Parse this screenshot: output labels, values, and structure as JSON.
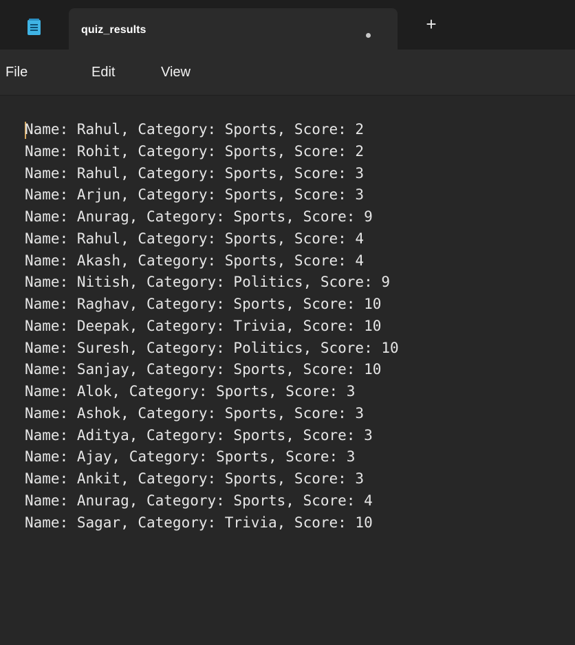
{
  "tab": {
    "title": "quiz_results",
    "unsaved_indicator": "●",
    "new_tab_label": "+"
  },
  "menu": {
    "file": "File",
    "edit": "Edit",
    "view": "View"
  },
  "document": {
    "lines": [
      "Name: Rahul, Category: Sports, Score: 2",
      "Name: Rohit, Category: Sports, Score: 2",
      "Name: Rahul, Category: Sports, Score: 3",
      "Name: Arjun, Category: Sports, Score: 3",
      "Name: Anurag, Category: Sports, Score: 9",
      "Name: Rahul, Category: Sports, Score: 4",
      "Name: Akash, Category: Sports, Score: 4",
      "Name: Nitish, Category: Politics, Score: 9",
      "Name: Raghav, Category: Sports, Score: 10",
      "Name: Deepak, Category: Trivia, Score: 10",
      "Name: Suresh, Category: Politics, Score: 10",
      "Name: Sanjay, Category: Sports, Score: 10",
      "Name: Alok, Category: Sports, Score: 3",
      "Name: Ashok, Category: Sports, Score: 3",
      "Name: Aditya, Category: Sports, Score: 3",
      "Name: Ajay, Category: Sports, Score: 3",
      "Name: Ankit, Category: Sports, Score: 3",
      "Name: Anurag, Category: Sports, Score: 4",
      "Name: Sagar, Category: Trivia, Score: 10"
    ]
  },
  "icons": {
    "app": "notepad-icon",
    "new_tab": "plus-icon"
  },
  "colors": {
    "background": "#272727",
    "titlebar": "#1e1e1e",
    "tab_active": "#2b2b2b",
    "text": "#e6e6e6",
    "caret": "#d6a85e",
    "notepad_icon": "#3fb4e5"
  }
}
